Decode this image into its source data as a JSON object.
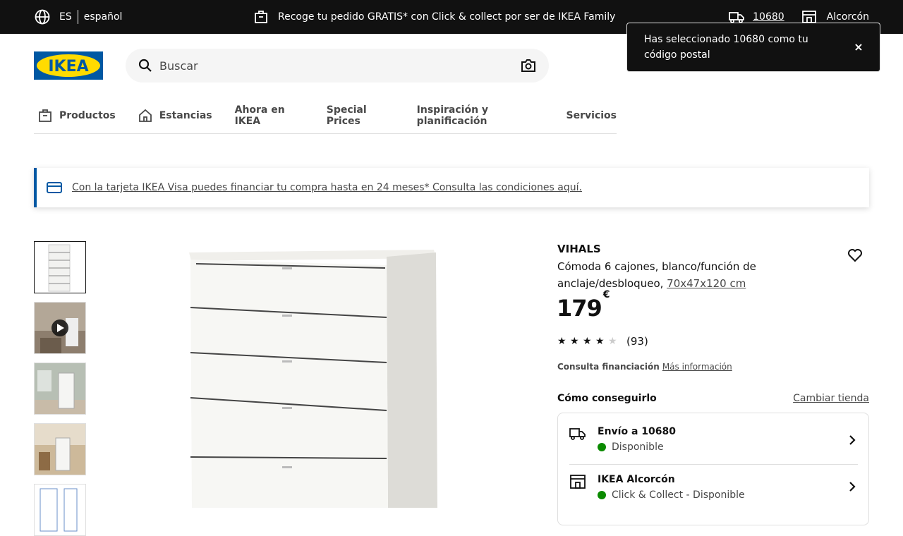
{
  "topbar": {
    "lang_code": "ES",
    "lang_name": "español",
    "promo": "Recoge tu pedido GRATIS* con Click & collect por ser de IKEA Family",
    "zip": "10680",
    "store": "Alcorcón"
  },
  "header": {
    "logo_text": "IKEA",
    "search_placeholder": "Buscar"
  },
  "toast": {
    "message": "Has seleccionado 10680 como tu código postal",
    "close": "×"
  },
  "nav": {
    "items": [
      {
        "label": "Productos",
        "icon": "box-icon"
      },
      {
        "label": "Estancias",
        "icon": "home-icon"
      },
      {
        "label": "Ahora en IKEA"
      },
      {
        "label": "Special Prices"
      },
      {
        "label": "Inspiración y planificación"
      },
      {
        "label": "Servicios"
      }
    ]
  },
  "banner": {
    "text": "Con la tarjeta IKEA Visa puedes financiar tu compra hasta en 24 meses* Consulta las condiciones aquí."
  },
  "product": {
    "name": "VIHALS",
    "description": "Cómoda 6 cajones, blanco/función de anclaje/desbloqueo,",
    "size": "70x47x120 cm",
    "price": "179",
    "currency": "€",
    "rating": 4.5,
    "review_count": "(93)",
    "financing_label": "Consulta financiación",
    "financing_link": "Más información"
  },
  "availability": {
    "heading": "Cómo conseguirlo",
    "change_store": "Cambiar tienda",
    "delivery": {
      "title": "Envío a 10680",
      "status": "Disponible"
    },
    "store": {
      "title": "IKEA Alcorcón",
      "status": "Click & Collect - Disponible"
    }
  },
  "colors": {
    "ikea_blue": "#0058a3",
    "ikea_yellow": "#ffdb00",
    "available_green": "#0a8a00",
    "topbar_bg": "#111111"
  }
}
